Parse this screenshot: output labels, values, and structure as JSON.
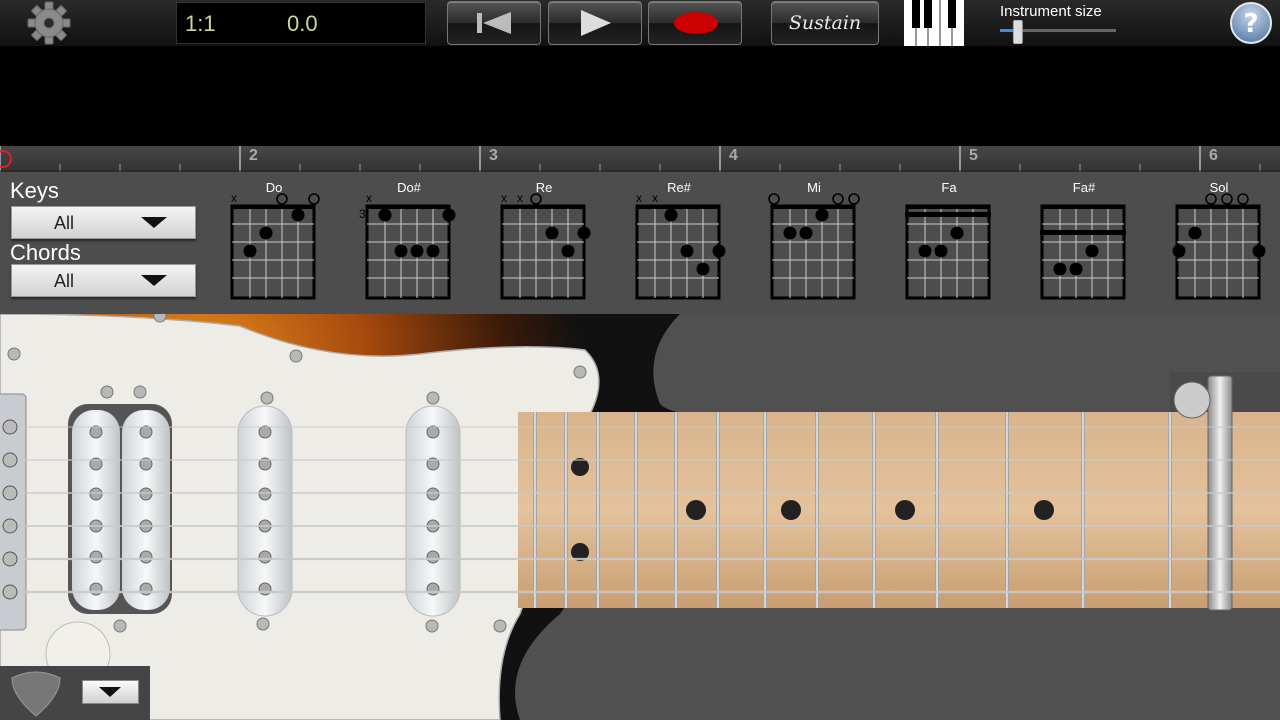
{
  "transport": {
    "position": "1:1",
    "tempo": "0.0",
    "sustain_label": "Sustain",
    "instrument_size_label": "Instrument size",
    "instrument_size_value": 0.15,
    "record_color": "#cc0000"
  },
  "timeline": {
    "measures": [
      "2",
      "3",
      "4",
      "5",
      "6"
    ]
  },
  "filters": {
    "keys_label": "Keys",
    "keys_value": "All",
    "chords_label": "Chords",
    "chords_value": "All"
  },
  "chords": [
    {
      "name": "Do"
    },
    {
      "name": "Do#",
      "fret_label": "3"
    },
    {
      "name": "Re"
    },
    {
      "name": "Re#"
    },
    {
      "name": "Mi"
    },
    {
      "name": "Fa"
    },
    {
      "name": "Fa#"
    },
    {
      "name": "Sol"
    }
  ],
  "icons": {
    "settings": "gear-icon",
    "rewind": "skip-back-icon",
    "play": "play-icon",
    "record": "record-icon",
    "piano": "piano-keys-icon",
    "help": "help-icon",
    "pick": "guitar-pick-icon"
  }
}
